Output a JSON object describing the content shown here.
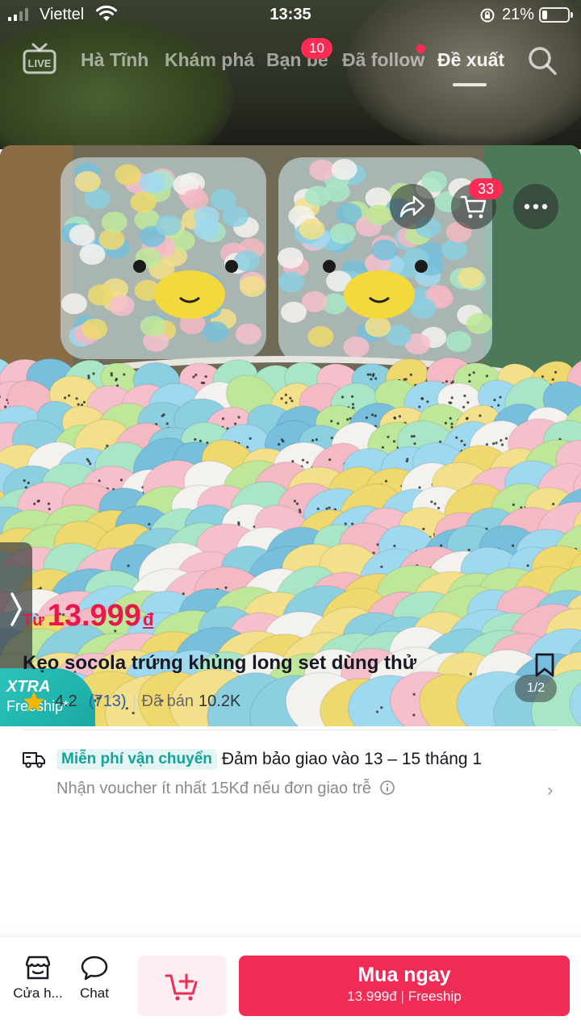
{
  "status_bar": {
    "carrier": "Viettel",
    "time": "13:35",
    "battery": "21%",
    "battery_level": 0.21
  },
  "top_nav": {
    "tabs": [
      {
        "label": "Hà Tĩnh"
      },
      {
        "label": "Khám phá"
      },
      {
        "label": "Bạn bè"
      },
      {
        "label": "Đã follow"
      },
      {
        "label": "Đề xuất"
      }
    ],
    "active_tab": "Đề xuất",
    "friends_badge": "10",
    "live_icon": "live-tv-icon",
    "search_icon": "search-icon"
  },
  "media": {
    "cart_badge": "33",
    "pager": "1/2",
    "xtra_label": "XTRA",
    "freeship_label": "Freeship*"
  },
  "product": {
    "price_prefix": "Từ",
    "price": "13.999",
    "currency": "đ",
    "title": "Kẹo socola trứng khủng long set dùng thử",
    "rating": "4.2",
    "rating_count": "(713)",
    "sold_label": "Đã bán",
    "sold_value": "10.2K"
  },
  "shipping": {
    "free_label": "Miễn phí vận chuyển",
    "guarantee": "Đảm bảo giao vào 13 – 15 tháng 1",
    "voucher": "Nhận voucher ít nhất 15Kđ nếu đơn giao trễ"
  },
  "bottom_bar": {
    "shop_label": "Cửa h...",
    "chat_label": "Chat",
    "buy_label": "Mua ngay",
    "buy_price": "13.999đ",
    "buy_ship": "Freeship"
  },
  "colors": {
    "accent": "#fe2c55",
    "price": "#e8184d",
    "buy_button": "#f02b55",
    "freeship_teal": "#14a39b"
  }
}
